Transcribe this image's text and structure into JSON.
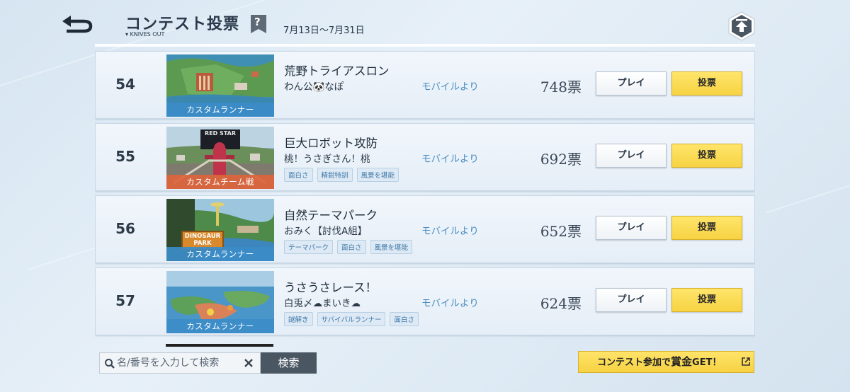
{
  "header": {
    "title": "コンテスト投票",
    "subtitle": "▾ KNIVES OUT",
    "help_icon": "?",
    "period": "7月13日〜7月31日"
  },
  "rows": [
    {
      "rank": "54",
      "thumbnail_label": "カスタムランナー",
      "map_name": "荒野トライアスロン",
      "author": "わん公🐼なぽ",
      "tags": [],
      "source": "モバイルより",
      "votes": "748票",
      "play_label": "プレイ",
      "vote_label": "投票"
    },
    {
      "rank": "55",
      "thumbnail_label": "カスタムチーム戦",
      "map_name": "巨大ロボット攻防",
      "author": "桃！うさぎさん！桃",
      "tags": [
        "面白さ",
        "精鋭特訓",
        "風景を堪能"
      ],
      "source": "モバイルより",
      "votes": "692票",
      "play_label": "プレイ",
      "vote_label": "投票"
    },
    {
      "rank": "56",
      "thumbnail_label": "カスタムランナー",
      "map_name": "自然テーマパーク",
      "author": "おみく【討伐A組】",
      "tags": [
        "テーマパーク",
        "面白さ",
        "風景を堪能"
      ],
      "source": "モバイルより",
      "votes": "652票",
      "play_label": "プレイ",
      "vote_label": "投票"
    },
    {
      "rank": "57",
      "thumbnail_label": "カスタムランナー",
      "map_name": "うさうさレース！",
      "author": "白兎〆☁まいき☁",
      "tags": [
        "謎解き",
        "サバイバルランナー",
        "面白さ"
      ],
      "source": "モバイルより",
      "votes": "624票",
      "play_label": "プレイ",
      "vote_label": "投票"
    }
  ],
  "thumbnail_texts": {
    "row55_sign": "RED STAR",
    "row56_sign": "DINOSAUR PARK"
  },
  "search": {
    "placeholder": "名/番号を入力して検索",
    "button_label": "検索"
  },
  "contest_button": {
    "prefix": "コンテスト参加で",
    "highlight": "賞金",
    "suffix": "GET！"
  },
  "colors": {
    "accent_yellow": "#f7d343",
    "link_blue": "#4b8dc0",
    "search_button": "#4b5663"
  },
  "icons": [
    "back-arrow-icon",
    "help-icon",
    "scroll-top-icon",
    "search-icon",
    "clear-icon",
    "external-link-icon"
  ]
}
